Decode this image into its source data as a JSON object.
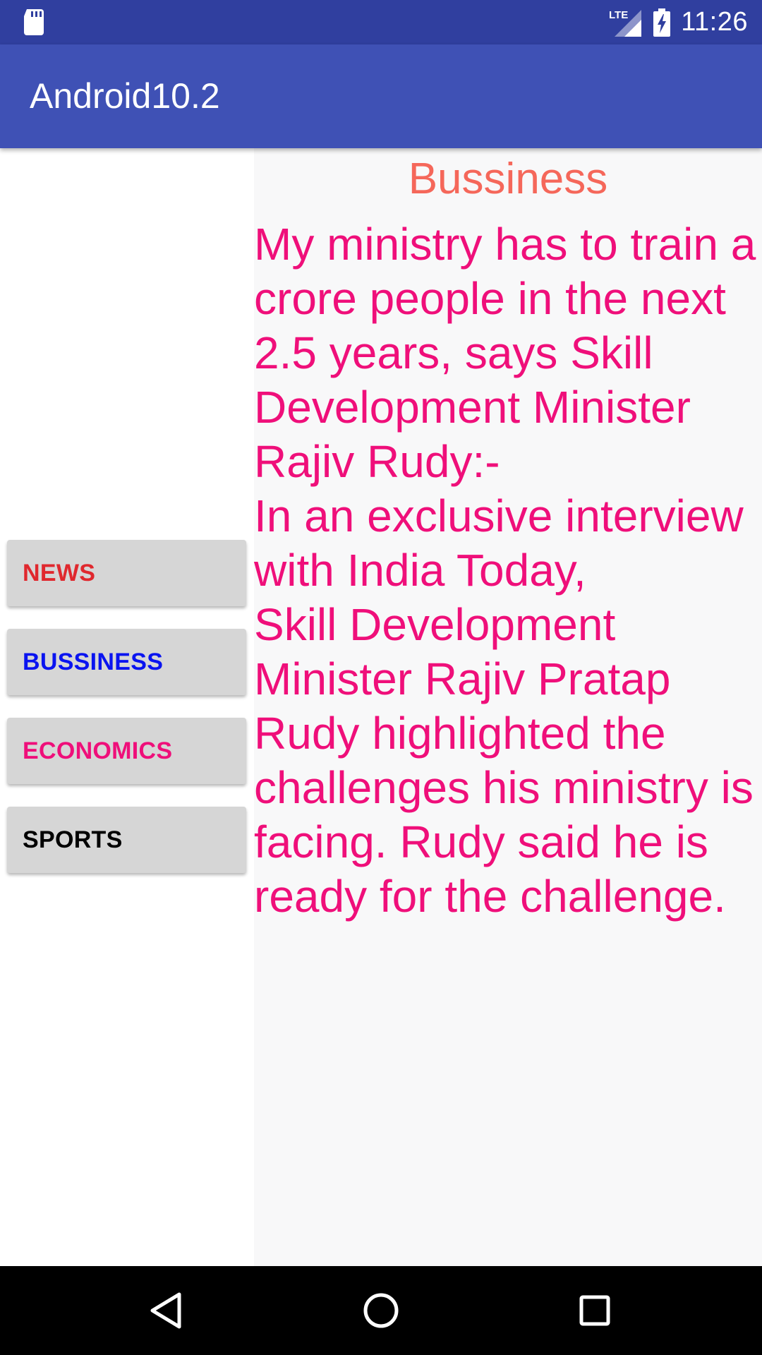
{
  "status_bar": {
    "time": "11:26",
    "network_label": "LTE",
    "icons": [
      "sd-card-icon",
      "lte-signal-icon",
      "battery-charging-icon"
    ]
  },
  "app_bar": {
    "title": "Android10.2",
    "background": "#3f51b5"
  },
  "menu": {
    "buttons": [
      {
        "label": "NEWS",
        "color": "#e0282e"
      },
      {
        "label": "BUSSINESS",
        "color": "#0a14f0"
      },
      {
        "label": "ECONOMICS",
        "color": "#ef0f7a"
      },
      {
        "label": "SPORTS",
        "color": "#000000"
      }
    ]
  },
  "article": {
    "title": "Bussiness",
    "title_color": "#f5675a",
    "body": "My ministry has to train a crore people in the next 2.5 years, says Skill Development Minister Rajiv Rudy:-\nIn an exclusive interview with India Today,\nSkill Development Minister Rajiv Pratap Rudy highlighted the challenges his ministry is facing. Rudy said he is ready for the challenge.",
    "body_color": "#ef0f7a"
  },
  "nav_bar": {
    "icons": [
      "back-icon",
      "home-icon",
      "recents-icon"
    ]
  }
}
